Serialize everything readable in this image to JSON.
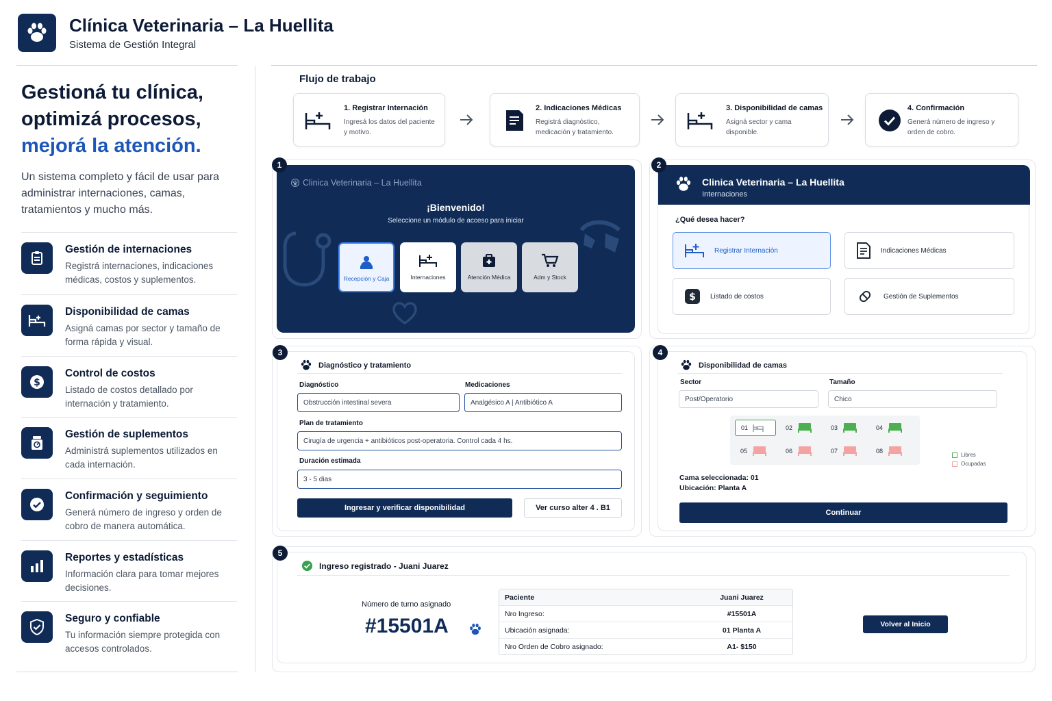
{
  "header": {
    "title": "Clínica Veterinaria – La Huellita",
    "subtitle": "Sistema de Gestión Integral"
  },
  "hero": {
    "line1": "Gestioná tu clínica,",
    "line2": "optimizá procesos,",
    "line3": "mejorá la atención.",
    "description": "Un sistema completo y fácil de usar para administrar internaciones, camas, tratamientos y mucho más."
  },
  "features": [
    {
      "icon": "clipboard-icon",
      "title": "Gestión de internaciones",
      "desc": "Registrá internaciones, indicaciones médicas, costos y suplementos."
    },
    {
      "icon": "bed-icon",
      "title": "Disponibilidad de camas",
      "desc": "Asigná camas por sector y tamaño de forma rápida y visual."
    },
    {
      "icon": "dollar-icon",
      "title": "Control de costos",
      "desc": "Listado de costos detallado por internación y tratamiento."
    },
    {
      "icon": "supplement-icon",
      "title": "Gestión de suplementos",
      "desc": "Administrá suplementos utilizados en cada internación."
    },
    {
      "icon": "check-circle-icon",
      "title": "Confirmación y seguimiento",
      "desc": "Generá número de ingreso y orden de cobro de manera automática."
    },
    {
      "icon": "bar-chart-icon",
      "title": "Reportes y estadísticas",
      "desc": "Información clara para tomar mejores decisiones."
    },
    {
      "icon": "shield-icon",
      "title": "Seguro y confiable",
      "desc": "Tu información siempre protegida con accesos controlados."
    }
  ],
  "workflow": {
    "title": "Flujo de trabajo",
    "steps": [
      {
        "icon": "bed-plus-icon",
        "title": "1. Registrar Internación",
        "desc": "Ingresá los datos del paciente y motivo."
      },
      {
        "icon": "document-icon",
        "title": "2. Indicaciones Médicas",
        "desc": "Registrá diagnóstico, medicación y tratamiento."
      },
      {
        "icon": "bed-plus-icon",
        "title": "3. Disponibilidad de camas",
        "desc": "Asigná sector y cama disponible."
      },
      {
        "icon": "check-circle-icon",
        "title": "4. Confirmación",
        "desc": "Generá número de ingreso y orden de cobro."
      }
    ]
  },
  "panel1": {
    "badge": "1",
    "brand": "Clinica Veterinaria – La Huellita",
    "welcome": "¡Bienvenido!",
    "select_text": "Seleccione un módulo de acceso para iniciar",
    "modules": [
      {
        "icon": "receptionist-icon",
        "label": "Recepción y Caja"
      },
      {
        "icon": "bed-plus-icon",
        "label": "Internaciones"
      },
      {
        "icon": "medical-bag-icon",
        "label": "Atención Médica"
      },
      {
        "icon": "cart-icon",
        "label": "Adm y Stock"
      }
    ]
  },
  "panel2": {
    "badge": "2",
    "title": "Clinica Veterinaria – La Huellita",
    "subtitle": "Internaciones",
    "question": "¿Qué desea hacer?",
    "options": [
      {
        "icon": "bed-plus-icon",
        "label": "Registrar Internación"
      },
      {
        "icon": "document-icon",
        "label": "Indicaciones Médicas"
      },
      {
        "icon": "dollar-icon",
        "label": "Listado de costos"
      },
      {
        "icon": "pill-icon",
        "label": "Gestión de Suplementos"
      }
    ]
  },
  "panel3": {
    "badge": "3",
    "title": "Diagnóstico y tratamiento",
    "diag_label": "Diagnóstico",
    "diag_value": "Obstrucción intestinal severa",
    "med_label": "Medicaciones",
    "med_value": "Analgésico A | Antibiótico A",
    "plan_label": "Plan de tratamiento",
    "plan_value": "Cirugía de urgencia + antibióticos post-operatoria. Control cada 4 hs.",
    "dur_label": "Duración estimada",
    "dur_value": "3 - 5 dias",
    "primary_btn": "Ingresar y verificar disponibilidad",
    "secondary_btn": "Ver curso alter 4 . B1"
  },
  "panel4": {
    "badge": "4",
    "title": "Disponibilidad de camas",
    "sector_label": "Sector",
    "sector_value": "Post/Operatorio",
    "size_label": "Tamaño",
    "size_value": "Chico",
    "beds": [
      {
        "num": "01",
        "status": "selected"
      },
      {
        "num": "02",
        "status": "free"
      },
      {
        "num": "03",
        "status": "free"
      },
      {
        "num": "04",
        "status": "free"
      },
      {
        "num": "05",
        "status": "occupied"
      },
      {
        "num": "06",
        "status": "occupied"
      },
      {
        "num": "07",
        "status": "occupied"
      },
      {
        "num": "08",
        "status": "occupied"
      }
    ],
    "legend_free": "Libres",
    "legend_occupied": "Ocupadas",
    "selected_bed": "Cama seleccionada: 01",
    "location": "Ubicación: Planta A",
    "continue_btn": "Continuar"
  },
  "panel5": {
    "badge": "5",
    "title": "Ingreso registrado - Juani Juarez",
    "turn_label": "Número de turno asignado",
    "turn_number": "#15501A",
    "rows": [
      {
        "key": "Paciente",
        "value": "Juani Juarez"
      },
      {
        "key": "Nro Ingreso:",
        "value": "#15501A"
      },
      {
        "key": "Ubicación asignada:",
        "value": "01 Planta A"
      },
      {
        "key": "Nro Orden de Cobro asignado:",
        "value": "A1- $150"
      }
    ],
    "back_btn": "Volver al Inicio"
  },
  "colors": {
    "navy": "#0f2b56",
    "accent_blue": "#1b56b8",
    "free_green": "#4caf50",
    "occupied_red": "#f4a3a3"
  }
}
